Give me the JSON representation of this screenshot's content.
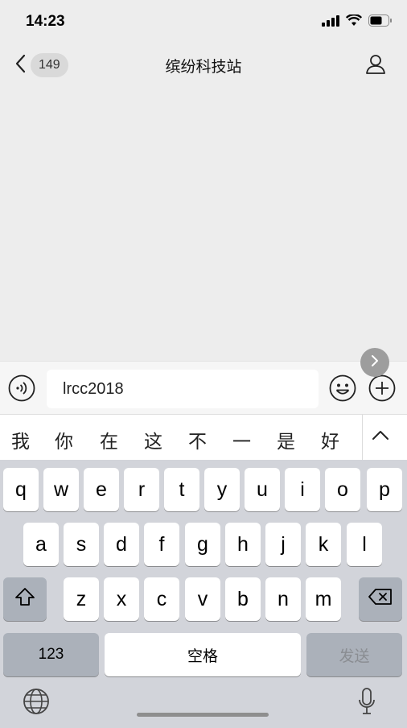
{
  "status": {
    "time": "14:23"
  },
  "nav": {
    "badge_count": "149",
    "title": "缤纷科技站"
  },
  "input": {
    "value": "lrcc2018"
  },
  "candidates": [
    "我",
    "你",
    "在",
    "这",
    "不",
    "一",
    "是",
    "好"
  ],
  "keyboard": {
    "row1": [
      "q",
      "w",
      "e",
      "r",
      "t",
      "y",
      "u",
      "i",
      "o",
      "p"
    ],
    "row2": [
      "a",
      "s",
      "d",
      "f",
      "g",
      "h",
      "j",
      "k",
      "l"
    ],
    "row3": [
      "z",
      "x",
      "c",
      "v",
      "b",
      "n",
      "m"
    ],
    "numbers_label": "123",
    "space_label": "空格",
    "send_label": "发送"
  },
  "icons": {
    "back": "chevron-left-icon",
    "profile": "person-icon",
    "voice": "voice-icon",
    "emoji": "smiley-icon",
    "plus": "plus-icon",
    "shift": "shift-icon",
    "delete": "backspace-icon",
    "globe": "globe-icon",
    "mic": "microphone-icon"
  }
}
